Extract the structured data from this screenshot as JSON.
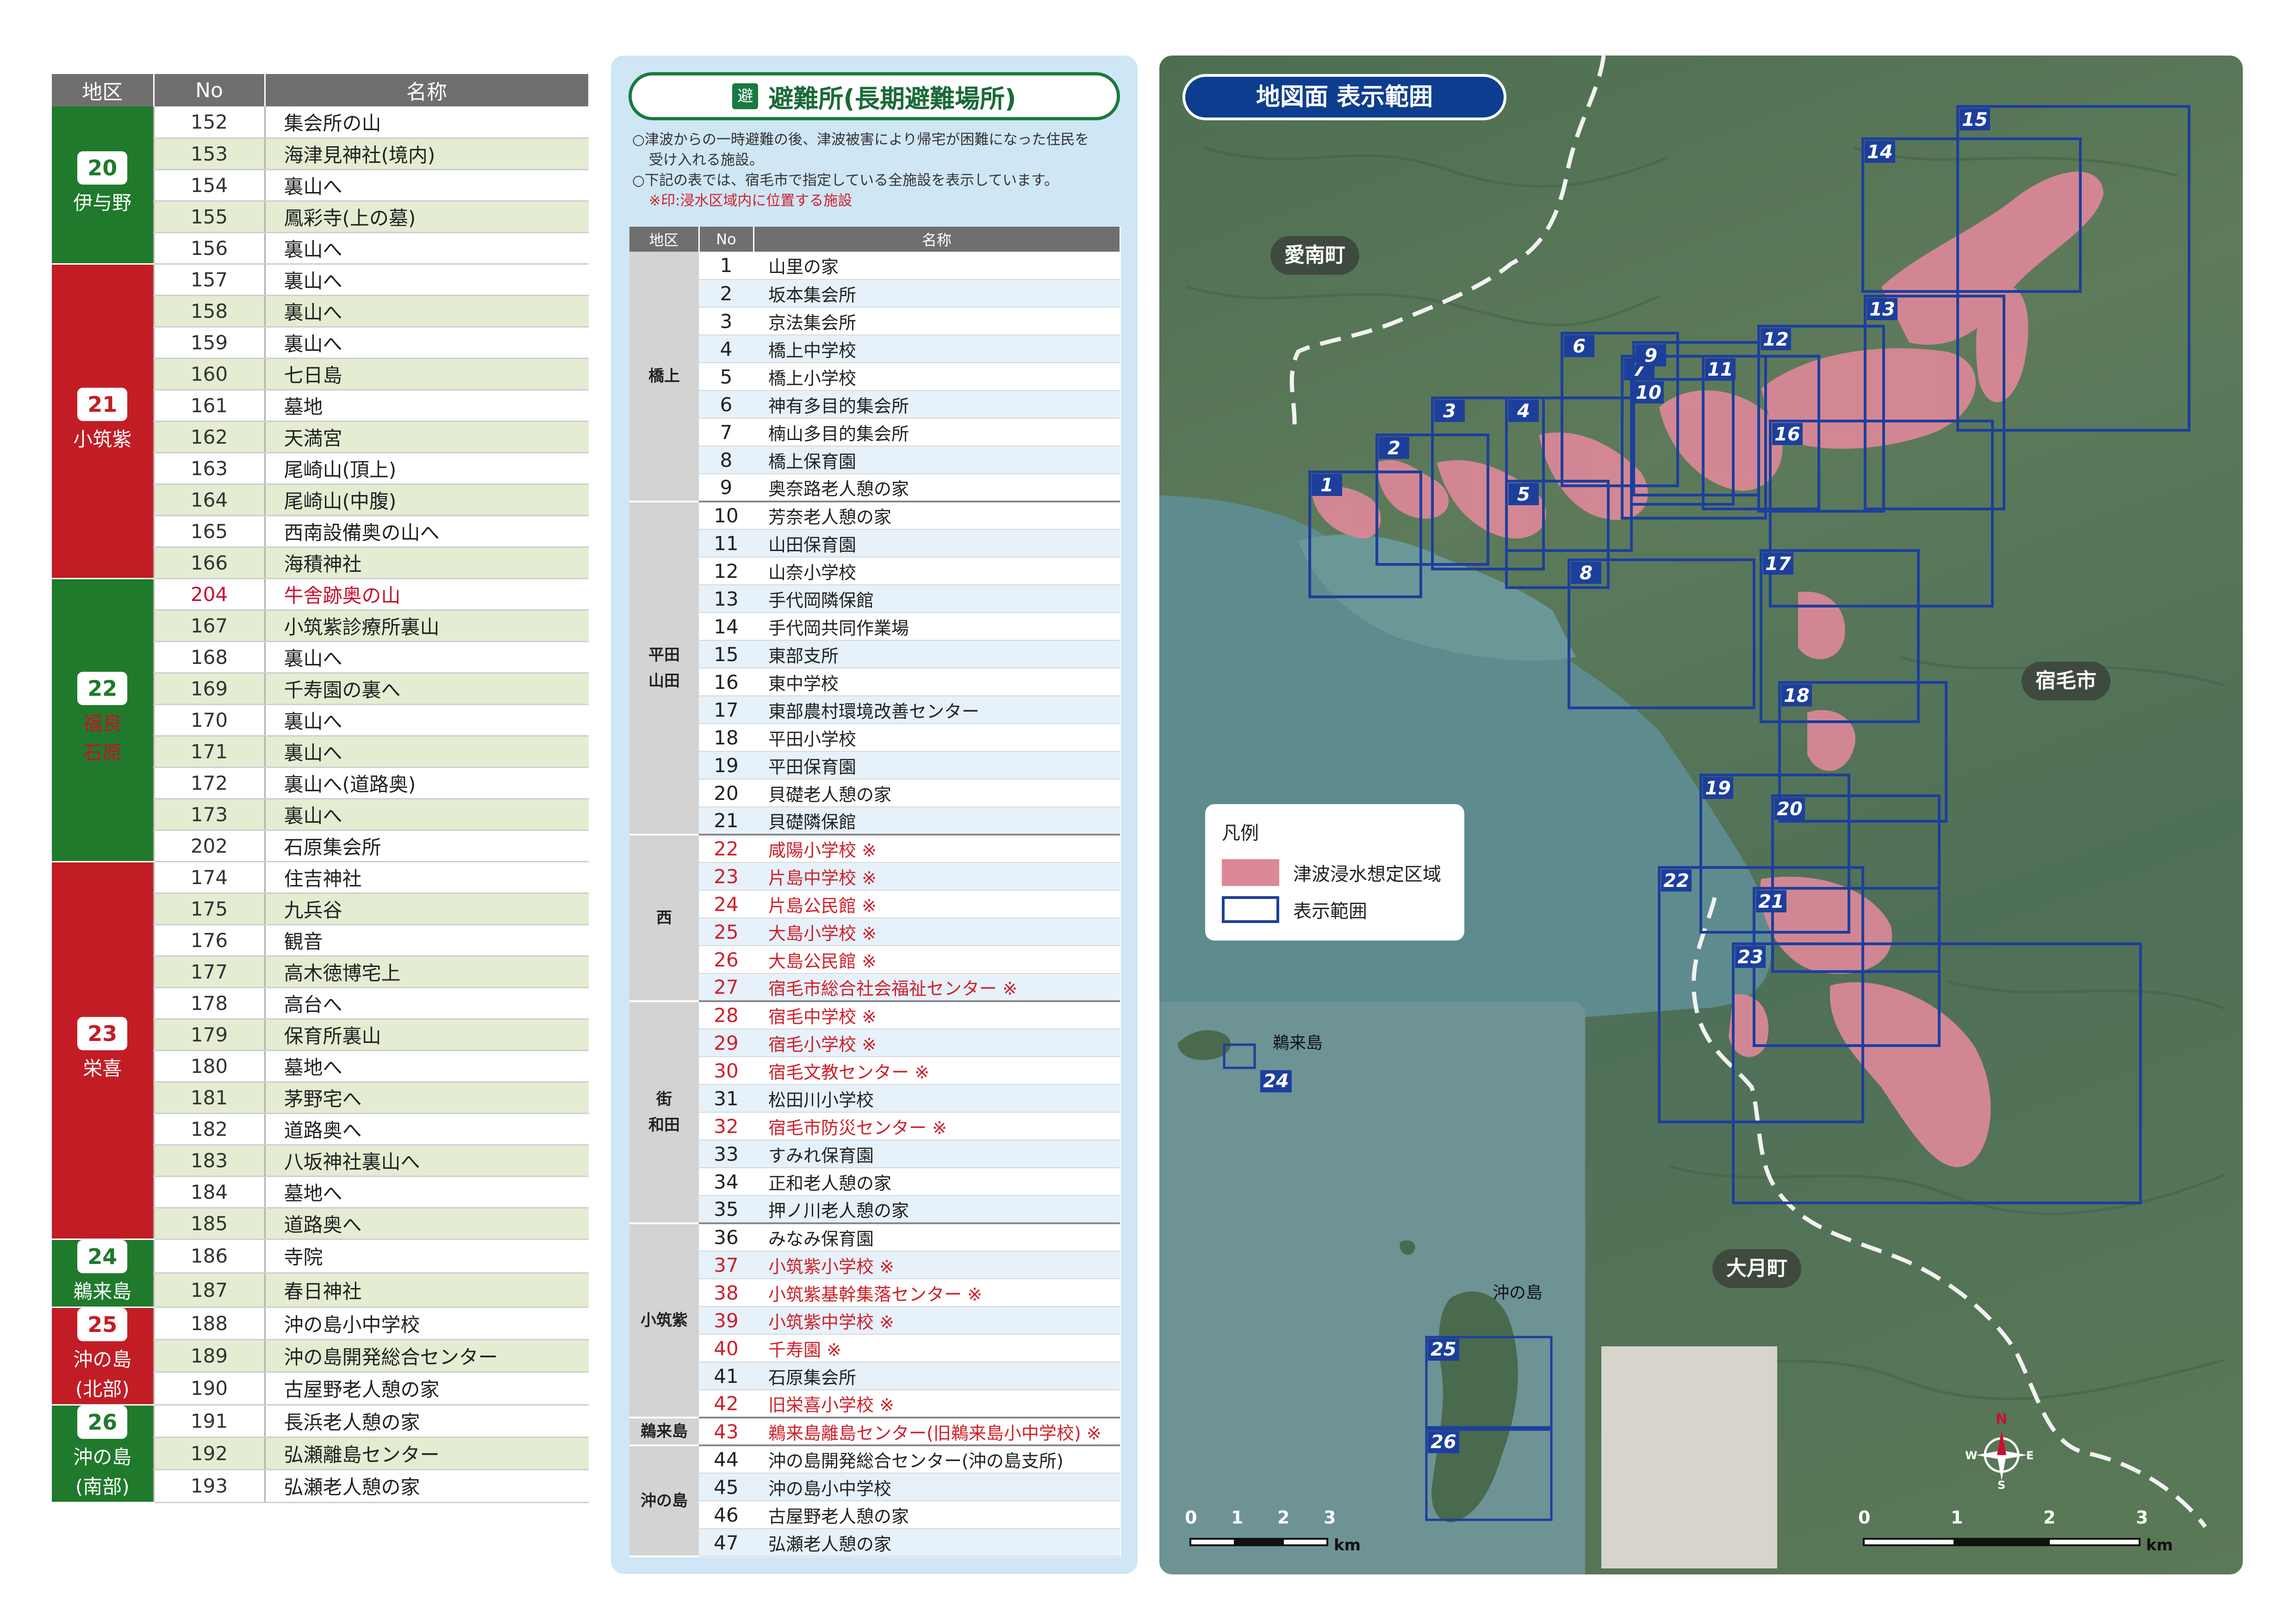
{
  "left_table": {
    "headers": [
      "地区",
      "No",
      "名称"
    ],
    "groups": [
      {
        "code": "20",
        "name": "伊与野",
        "color": "green",
        "rows": [
          {
            "no": "152",
            "name": "集会所の山"
          },
          {
            "no": "153",
            "name": "海津見神社(境内)"
          },
          {
            "no": "154",
            "name": "裏山へ"
          },
          {
            "no": "155",
            "name": "鳳彩寺(上の墓)"
          },
          {
            "no": "156",
            "name": "裏山へ"
          }
        ]
      },
      {
        "code": "21",
        "name": "小筑紫",
        "color": "red",
        "rows": [
          {
            "no": "157",
            "name": "裏山へ"
          },
          {
            "no": "158",
            "name": "裏山へ"
          },
          {
            "no": "159",
            "name": "裏山へ"
          },
          {
            "no": "160",
            "name": "七日島"
          },
          {
            "no": "161",
            "name": "墓地"
          },
          {
            "no": "162",
            "name": "天満宮"
          },
          {
            "no": "163",
            "name": "尾崎山(頂上)"
          },
          {
            "no": "164",
            "name": "尾崎山(中腹)"
          },
          {
            "no": "165",
            "name": "西南設備奥の山へ"
          },
          {
            "no": "166",
            "name": "海積神社"
          }
        ]
      },
      {
        "code": "22",
        "name": "福良\n石原",
        "color": "green",
        "rows": [
          {
            "no": "204",
            "name": "牛舎跡奥の山",
            "red": true
          },
          {
            "no": "167",
            "name": "小筑紫診療所裏山"
          },
          {
            "no": "168",
            "name": "裏山へ"
          },
          {
            "no": "169",
            "name": "千寿園の裏へ"
          },
          {
            "no": "170",
            "name": "裏山へ"
          },
          {
            "no": "171",
            "name": "裏山へ"
          },
          {
            "no": "172",
            "name": "裏山へ(道路奥)"
          },
          {
            "no": "173",
            "name": "裏山へ"
          },
          {
            "no": "202",
            "name": "石原集会所"
          }
        ]
      },
      {
        "code": "23",
        "name": "栄喜",
        "color": "red",
        "rows": [
          {
            "no": "174",
            "name": "住吉神社"
          },
          {
            "no": "175",
            "name": "九兵谷"
          },
          {
            "no": "176",
            "name": "観音"
          },
          {
            "no": "177",
            "name": "高木徳博宅上"
          },
          {
            "no": "178",
            "name": "高台へ"
          },
          {
            "no": "179",
            "name": "保育所裏山"
          },
          {
            "no": "180",
            "name": "墓地へ"
          },
          {
            "no": "181",
            "name": "茅野宅へ"
          },
          {
            "no": "182",
            "name": "道路奥へ"
          },
          {
            "no": "183",
            "name": "八坂神社裏山へ"
          },
          {
            "no": "184",
            "name": "墓地へ"
          },
          {
            "no": "185",
            "name": "道路奥へ"
          }
        ]
      },
      {
        "code": "24",
        "name": "鵜来島",
        "color": "green",
        "rows": [
          {
            "no": "186",
            "name": "寺院"
          },
          {
            "no": "187",
            "name": "春日神社"
          }
        ]
      },
      {
        "code": "25",
        "name": "沖の島\n(北部)",
        "color": "red",
        "rows": [
          {
            "no": "188",
            "name": "沖の島小中学校"
          },
          {
            "no": "189",
            "name": "沖の島開発総合センター"
          },
          {
            "no": "190",
            "name": "古屋野老人憩の家"
          }
        ]
      },
      {
        "code": "26",
        "name": "沖の島\n(南部)",
        "color": "green",
        "rows": [
          {
            "no": "191",
            "name": "長浜老人憩の家"
          },
          {
            "no": "192",
            "name": "弘瀬離島センター"
          },
          {
            "no": "193",
            "name": "弘瀬老人憩の家"
          }
        ]
      }
    ]
  },
  "shelter_panel": {
    "icon": "避",
    "title": "避難所(長期避難場所)",
    "notes": [
      "○津波からの一時避難の後、津波被害により帰宅が困難になった住民を",
      "受け入れる施設。",
      "○下記の表では、宿毛市で指定している全施設を表示しています。"
    ],
    "note_red": "※印:浸水区域内に位置する施設",
    "headers": [
      "地区",
      "No",
      "名称"
    ],
    "groups": [
      {
        "district": "橋上",
        "rows": [
          {
            "no": "1",
            "name": "山里の家"
          },
          {
            "no": "2",
            "name": "坂本集会所"
          },
          {
            "no": "3",
            "name": "京法集会所"
          },
          {
            "no": "4",
            "name": "橋上中学校"
          },
          {
            "no": "5",
            "name": "橋上小学校"
          },
          {
            "no": "6",
            "name": "神有多目的集会所"
          },
          {
            "no": "7",
            "name": "楠山多目的集会所"
          },
          {
            "no": "8",
            "name": "橋上保育園"
          },
          {
            "no": "9",
            "name": "奥奈路老人憩の家"
          }
        ]
      },
      {
        "district": "平田\n山田",
        "rows": [
          {
            "no": "10",
            "name": "芳奈老人憩の家"
          },
          {
            "no": "11",
            "name": "山田保育園"
          },
          {
            "no": "12",
            "name": "山奈小学校"
          },
          {
            "no": "13",
            "name": "手代岡隣保館"
          },
          {
            "no": "14",
            "name": "手代岡共同作業場"
          },
          {
            "no": "15",
            "name": "東部支所"
          },
          {
            "no": "16",
            "name": "東中学校"
          },
          {
            "no": "17",
            "name": "東部農村環境改善センター"
          },
          {
            "no": "18",
            "name": "平田小学校"
          },
          {
            "no": "19",
            "name": "平田保育園"
          },
          {
            "no": "20",
            "name": "貝礎老人憩の家"
          },
          {
            "no": "21",
            "name": "貝礎隣保館"
          }
        ]
      },
      {
        "district": "西",
        "rows": [
          {
            "no": "22",
            "name": "咸陽小学校 ※",
            "red": true
          },
          {
            "no": "23",
            "name": "片島中学校 ※",
            "red": true
          },
          {
            "no": "24",
            "name": "片島公民館 ※",
            "red": true
          },
          {
            "no": "25",
            "name": "大島小学校 ※",
            "red": true
          },
          {
            "no": "26",
            "name": "大島公民館 ※",
            "red": true
          },
          {
            "no": "27",
            "name": "宿毛市総合社会福祉センター ※",
            "red": true
          }
        ]
      },
      {
        "district": "街\n和田",
        "rows": [
          {
            "no": "28",
            "name": "宿毛中学校 ※",
            "red": true
          },
          {
            "no": "29",
            "name": "宿毛小学校 ※",
            "red": true
          },
          {
            "no": "30",
            "name": "宿毛文教センター ※",
            "red": true
          },
          {
            "no": "31",
            "name": "松田川小学校"
          },
          {
            "no": "32",
            "name": "宿毛市防災センター ※",
            "red": true
          },
          {
            "no": "33",
            "name": "すみれ保育園"
          },
          {
            "no": "34",
            "name": "正和老人憩の家"
          },
          {
            "no": "35",
            "name": "押ノ川老人憩の家"
          }
        ]
      },
      {
        "district": "小筑紫",
        "rows": [
          {
            "no": "36",
            "name": "みなみ保育園"
          },
          {
            "no": "37",
            "name": "小筑紫小学校 ※",
            "red": true
          },
          {
            "no": "38",
            "name": "小筑紫基幹集落センター ※",
            "red": true
          },
          {
            "no": "39",
            "name": "小筑紫中学校 ※",
            "red": true
          },
          {
            "no": "40",
            "name": "千寿園 ※",
            "red": true
          },
          {
            "no": "41",
            "name": "石原集会所"
          },
          {
            "no": "42",
            "name": "旧栄喜小学校 ※",
            "red": true
          }
        ]
      },
      {
        "district": "鵜来島",
        "rows": [
          {
            "no": "43",
            "name": "鵜来島離島センター(旧鵜来島小中学校) ※",
            "red": true
          }
        ]
      },
      {
        "district": "沖の島",
        "rows": [
          {
            "no": "44",
            "name": "沖の島開発総合センター(沖の島支所)"
          },
          {
            "no": "45",
            "name": "沖の島小中学校"
          },
          {
            "no": "46",
            "name": "古屋野老人憩の家"
          },
          {
            "no": "47",
            "name": "弘瀬老人憩の家"
          }
        ]
      }
    ]
  },
  "map": {
    "title": "地図面 表示範囲",
    "place_labels": [
      "愛南町",
      "宿毛市",
      "大月町"
    ],
    "inset_labels": [
      "鵜来島",
      "沖の島"
    ],
    "legend": {
      "title": "凡例",
      "flood_label": "津波浸水想定区域",
      "range_label": "表示範囲"
    },
    "scale_ticks": [
      "0",
      "1",
      "2",
      "3"
    ],
    "scale_unit": "km",
    "compass": {
      "n": "N",
      "s": "S",
      "e": "E",
      "w": "W"
    },
    "sheet_numbers": [
      "1",
      "2",
      "3",
      "4",
      "5",
      "6",
      "7",
      "8",
      "9",
      "10",
      "11",
      "12",
      "13",
      "14",
      "15",
      "16",
      "17",
      "18",
      "19",
      "20",
      "21",
      "22",
      "23",
      "24",
      "25",
      "26"
    ],
    "colors": {
      "flood": "#dc8898",
      "range": "#1d3f9c",
      "label_bg": "#0c3d8f"
    }
  }
}
